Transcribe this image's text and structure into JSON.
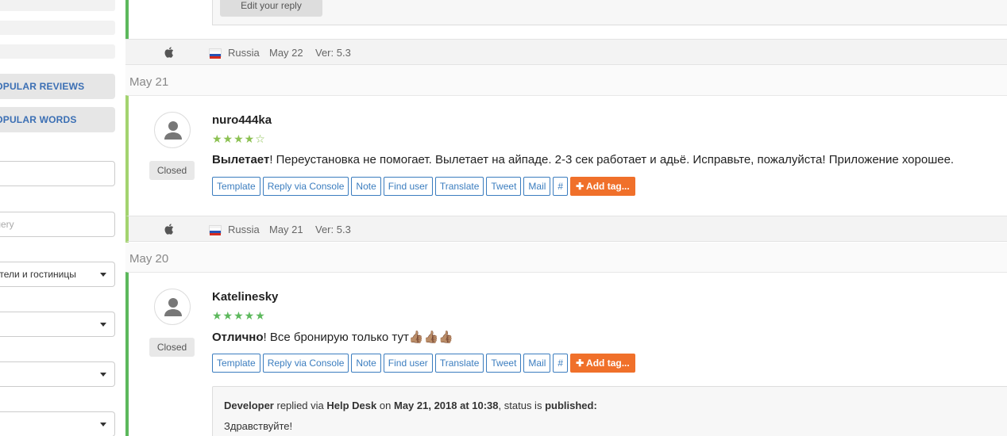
{
  "sidebar": {
    "popular_reviews_label": "POPULAR REVIEWS",
    "popular_words_label": "POPULAR WORDS",
    "query_placeholder": "Query",
    "category_select": "Отели и гостиницы"
  },
  "top": {
    "edit_reply_label": "Edit your reply",
    "meta": {
      "country": "Russia",
      "date": "May 22",
      "version": "Ver: 5.3"
    }
  },
  "days": [
    {
      "label": "May 21"
    },
    {
      "label": "May 20"
    }
  ],
  "reviews": [
    {
      "author": "nuro444ka",
      "stars_filled": "★★★★",
      "stars_empty": "☆",
      "rating": 4,
      "title": "Вылетает",
      "text": "! Переустановка не помогает. Вылетает на айпаде. 2-3 сек работает и адьё. Исправьте, пожалуйста! Приложение хорошее.",
      "status": "Closed",
      "meta": {
        "country": "Russia",
        "date": "May 21",
        "version": "Ver: 5.3"
      }
    },
    {
      "author": "Katelinesky",
      "stars_filled": "★★★★★",
      "stars_empty": "",
      "rating": 5,
      "title": "Отлично",
      "text": "! Все бронирую только тут👍🏽👍🏽👍🏽",
      "status": "Closed",
      "reply": {
        "author": "Developer",
        "via_word": "replied via",
        "channel": "Help Desk",
        "on_word": "on",
        "date": "May 21, 2018 at 10:38",
        "status_prefix": ", status is",
        "status": "published:",
        "body": "Здравствуйте!"
      }
    }
  ],
  "actions": {
    "template": "Template",
    "reply_console": "Reply via Console",
    "note": "Note",
    "find_user": "Find user",
    "translate": "Translate",
    "tweet": "Tweet",
    "mail": "Mail",
    "hash": "#",
    "add_tag": "✚ Add tag..."
  },
  "colors": {
    "accent_green": "#5cb85c",
    "accent_light_green": "#a3d36f",
    "star_color": "#8cc152",
    "link_blue": "#3b7dbf",
    "tag_orange": "#f0702a"
  }
}
